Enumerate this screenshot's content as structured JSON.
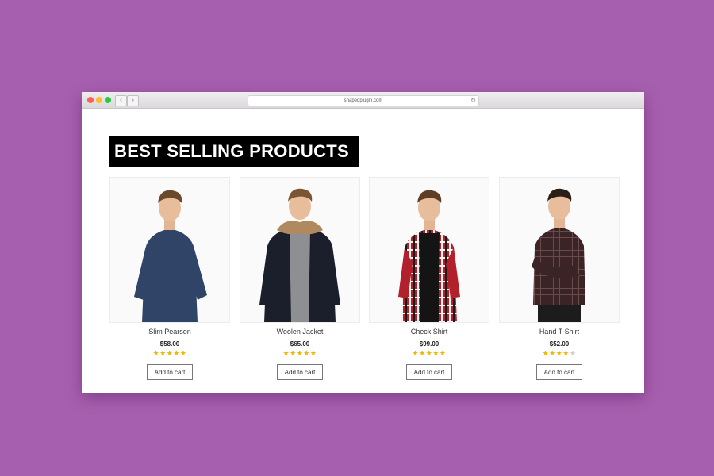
{
  "browser": {
    "url": "shapedplugin.com",
    "back_glyph": "‹",
    "forward_glyph": "›",
    "reload_glyph": "↻"
  },
  "section": {
    "title": "BEST SELLING PRODUCTS"
  },
  "products": [
    {
      "name": "Slim Pearson",
      "price": "$58.00",
      "rating": 5,
      "rating_max": 5,
      "cart_label": "Add to cart",
      "shirt_color": "#2f4466"
    },
    {
      "name": "Woolen Jacket",
      "price": "$65.00",
      "rating": 5,
      "rating_max": 5,
      "cart_label": "Add to cart",
      "shirt_color": "#1b1f2b"
    },
    {
      "name": "Check Shirt",
      "price": "$99.00",
      "rating": 5,
      "rating_max": 5,
      "cart_label": "Add to cart",
      "shirt_color": "#b2202c"
    },
    {
      "name": "Hand T-Shirt",
      "price": "$52.00",
      "rating": 4,
      "rating_max": 5,
      "cart_label": "Add to cart",
      "shirt_color": "#3a2426"
    }
  ],
  "colors": {
    "page_background": "#a65fae",
    "star_on": "#f3b600",
    "star_off": "#cfcfcf",
    "heading_background": "#000000"
  }
}
